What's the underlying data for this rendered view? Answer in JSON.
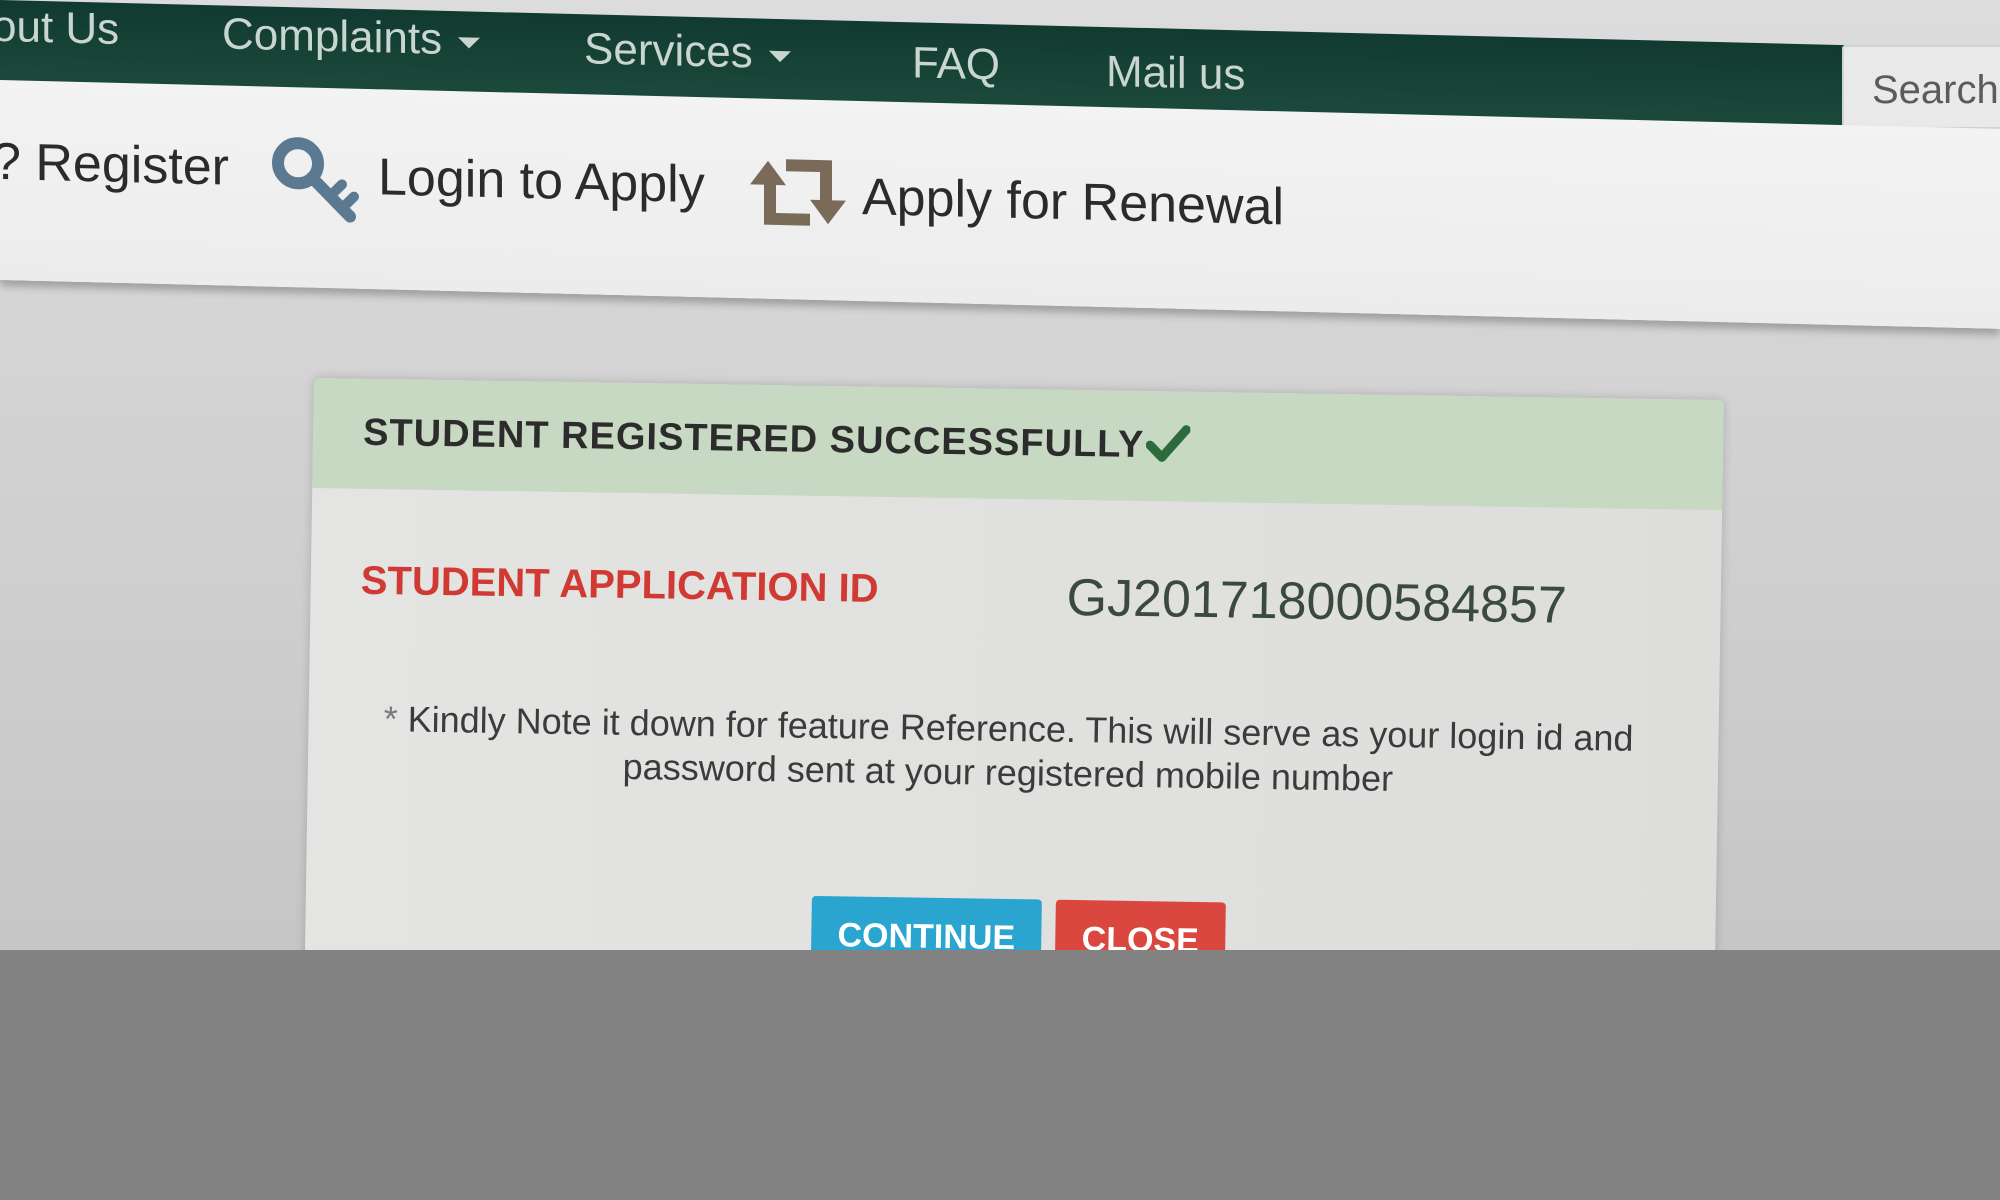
{
  "nav": {
    "items": [
      {
        "label": "out Us",
        "has_caret": false
      },
      {
        "label": "Complaints",
        "has_caret": true
      },
      {
        "label": "Services",
        "has_caret": true
      },
      {
        "label": "FAQ",
        "has_caret": false
      },
      {
        "label": "Mail us",
        "has_caret": false
      }
    ],
    "search_placeholder": "Search."
  },
  "subbar": {
    "register_label": "? Register",
    "login_label": "Login to Apply",
    "login_icon": "key-icon",
    "renewal_label": "Apply for Renewal",
    "renewal_icon": "renew-arrows-icon"
  },
  "dialog": {
    "title": "STUDENT REGISTERED SUCCESSFULLY",
    "title_icon": "checkmark-icon",
    "app_id_label": "STUDENT APPLICATION ID",
    "app_id_value": "GJ201718000584857",
    "note_star": "*",
    "note_text": "Kindly Note it down for feature Reference. This will serve as your login id and password sent at your registered mobile number",
    "continue_label": "CONTINUE",
    "close_label": "CLOSE"
  },
  "colors": {
    "nav_bg": "#1c4a3c",
    "header_green": "#c7d8c3",
    "id_label_red": "#d03a32",
    "continue_blue": "#2aa5cf",
    "close_red": "#d9473e",
    "check_green": "#2e6b3c"
  }
}
